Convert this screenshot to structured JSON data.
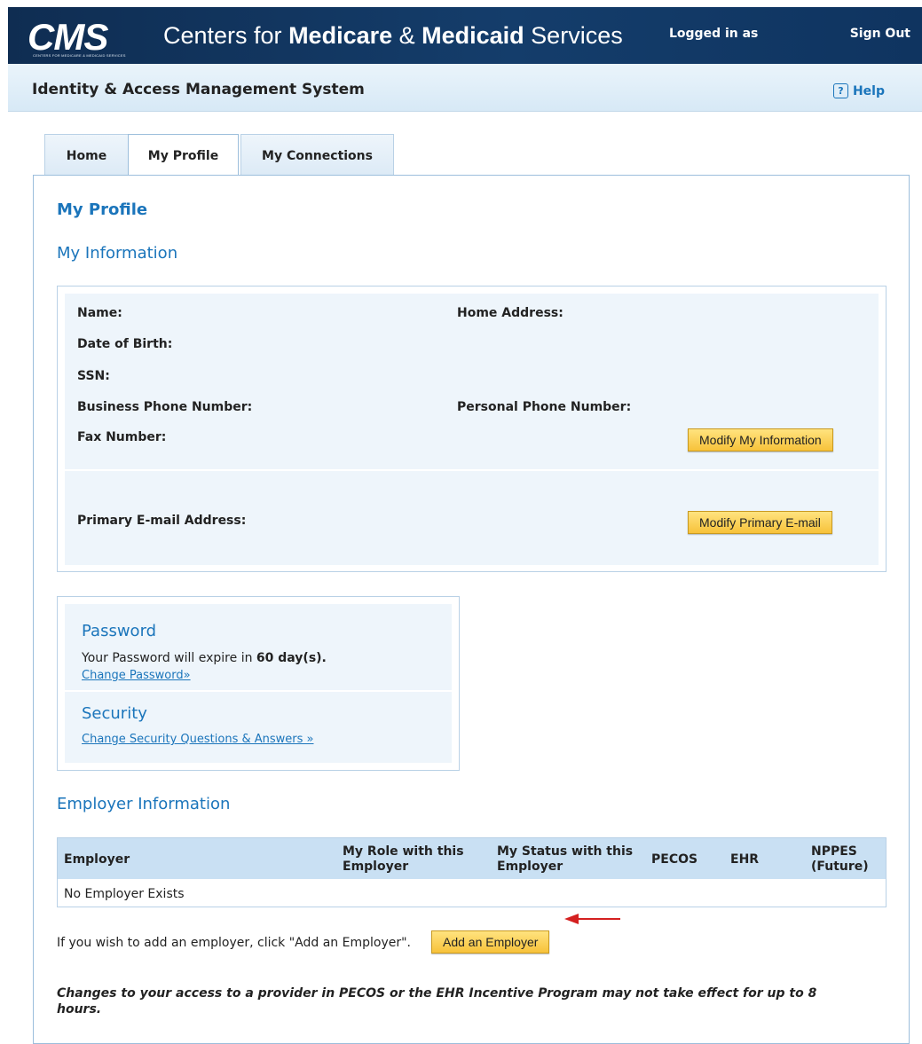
{
  "banner": {
    "logo_text": "CMS",
    "logo_subtext": "CENTERS FOR MEDICARE & MEDICAID SERVICES",
    "agency_part1": "Centers for ",
    "agency_part2": "Medicare",
    "agency_part3": " & ",
    "agency_part4": "Medicaid",
    "agency_part5": " Services",
    "logged_in_label": "Logged in as",
    "sign_out_label": "Sign Out"
  },
  "subheader": {
    "system_title": "Identity & Access Management System",
    "help_icon": "?",
    "help_label": "Help"
  },
  "tabs": [
    {
      "label": "Home",
      "active": false
    },
    {
      "label": "My Profile",
      "active": true
    },
    {
      "label": "My Connections",
      "active": false
    }
  ],
  "profile": {
    "page_title": "My Profile",
    "my_info_heading": "My Information",
    "labels": {
      "name": "Name:",
      "dob": "Date of Birth:",
      "ssn": "SSN:",
      "business_phone": "Business Phone Number:",
      "fax": "Fax Number:",
      "home_address": "Home Address:",
      "personal_phone": "Personal Phone Number:",
      "primary_email": "Primary E-mail Address:"
    },
    "modify_info_button": "Modify My Information",
    "modify_email_button": "Modify Primary E-mail"
  },
  "password": {
    "heading": "Password",
    "expire_text": "Your Password will expire in ",
    "expire_value": "60 day(s).",
    "change_link": "Change Password»"
  },
  "security": {
    "heading": "Security",
    "change_link": "Change Security Questions & Answers »"
  },
  "employer": {
    "heading": "Employer Information",
    "columns": [
      "Employer",
      "My Role with this Employer",
      "My Status with this Employer",
      "PECOS",
      "EHR",
      "NPPES (Future)"
    ],
    "empty_text": "No Employer Exists",
    "add_text": "If you wish to add an employer, click \"Add an Employer\".",
    "add_button": "Add an Employer",
    "note": "Changes to your access to a provider in PECOS or the EHR Incentive Program may not take effect for up to 8 hours."
  },
  "colors": {
    "banner": "#10345a",
    "accent": "#1b75bb",
    "button": "#f7c23a",
    "arrow": "#d42020"
  }
}
